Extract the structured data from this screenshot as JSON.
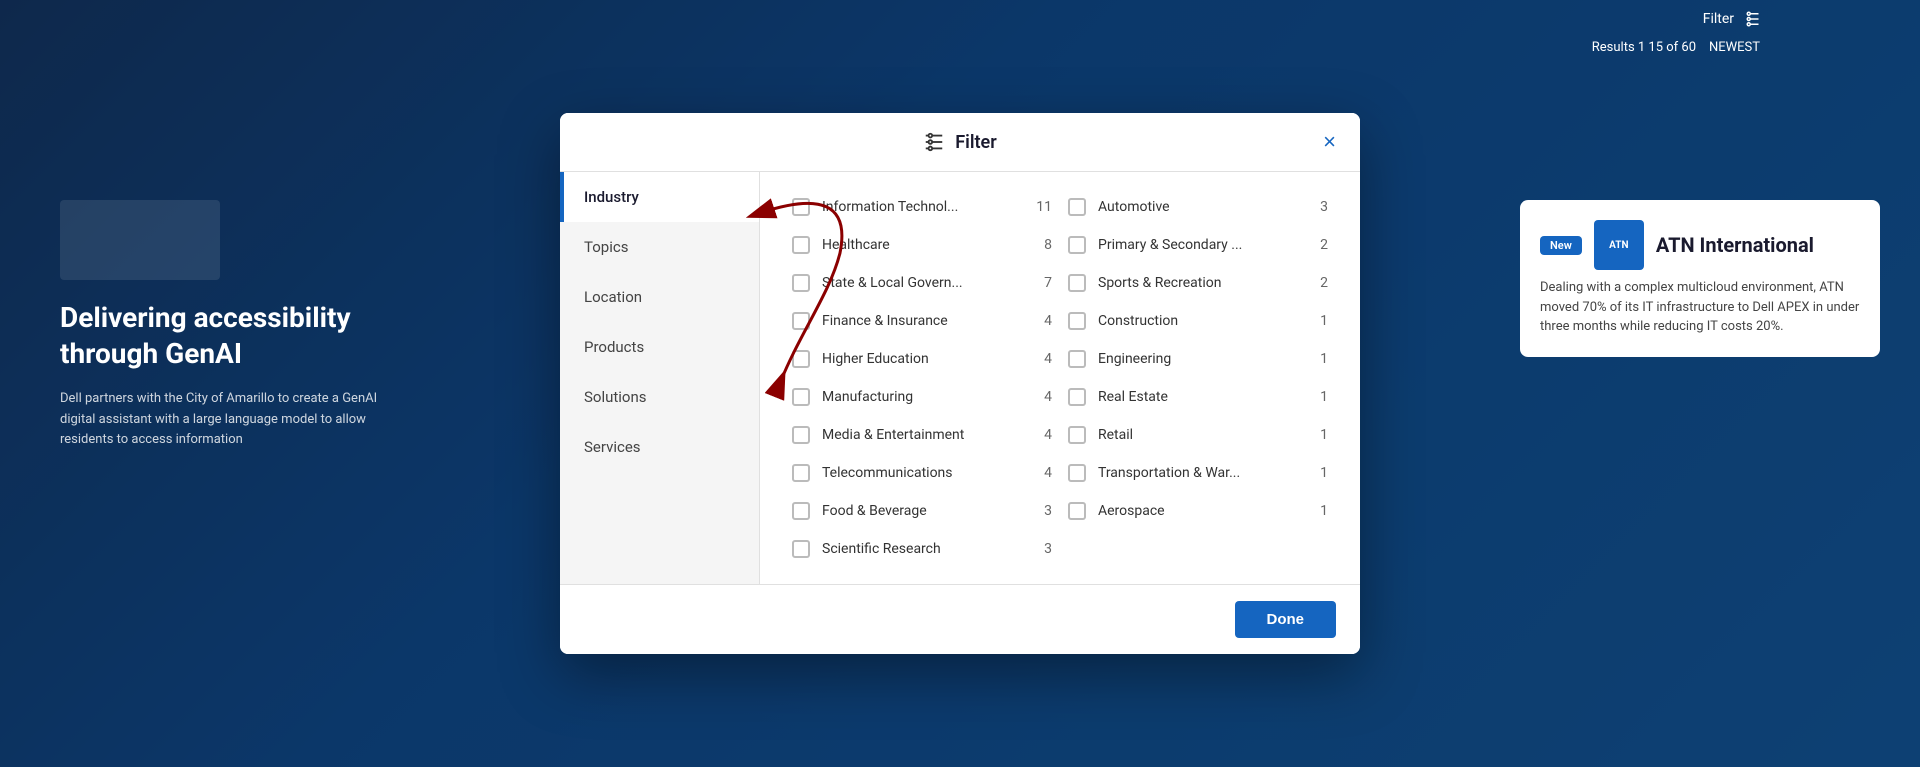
{
  "background": {
    "left_heading": "Delivering accessibility through GenAI",
    "left_body": "Dell partners with the City of Amarillo to create a GenAI digital assistant with a large language model to allow residents to access information",
    "right_company": "ATN International",
    "right_body": "Dealing with a complex multicloud environment, ATN moved 70% of its IT infrastructure to Dell APEX in under three months while reducing IT costs 20%.",
    "new_badge": "New",
    "filter_label": "Filter",
    "results_label": "Results 1 15 of 60",
    "newest_label": "NEWEST"
  },
  "modal": {
    "title": "Filter",
    "close_label": "×",
    "done_label": "Done"
  },
  "sidebar": {
    "items": [
      {
        "id": "industry",
        "label": "Industry",
        "active": true
      },
      {
        "id": "topics",
        "label": "Topics",
        "active": false
      },
      {
        "id": "location",
        "label": "Location",
        "active": false
      },
      {
        "id": "products",
        "label": "Products",
        "active": false
      },
      {
        "id": "solutions",
        "label": "Solutions",
        "active": false
      },
      {
        "id": "services",
        "label": "Services",
        "active": false
      }
    ]
  },
  "filters": {
    "left_column": [
      {
        "id": "info-tech",
        "label": "Information Technol...",
        "count": 11,
        "checked": false
      },
      {
        "id": "healthcare",
        "label": "Healthcare",
        "count": 8,
        "checked": false
      },
      {
        "id": "state-local",
        "label": "State & Local Govern...",
        "count": 7,
        "checked": false
      },
      {
        "id": "finance",
        "label": "Finance & Insurance",
        "count": 4,
        "checked": false
      },
      {
        "id": "higher-ed",
        "label": "Higher Education",
        "count": 4,
        "checked": false
      },
      {
        "id": "manufacturing",
        "label": "Manufacturing",
        "count": 4,
        "checked": false
      },
      {
        "id": "media",
        "label": "Media & Entertainment",
        "count": 4,
        "checked": false
      },
      {
        "id": "telecom",
        "label": "Telecommunications",
        "count": 4,
        "checked": false
      },
      {
        "id": "food-bev",
        "label": "Food & Beverage",
        "count": 3,
        "checked": false
      },
      {
        "id": "sci-research",
        "label": "Scientific Research",
        "count": 3,
        "checked": false
      }
    ],
    "right_column": [
      {
        "id": "automotive",
        "label": "Automotive",
        "count": 3,
        "checked": false
      },
      {
        "id": "primary-secondary",
        "label": "Primary & Secondary ...",
        "count": 2,
        "checked": false
      },
      {
        "id": "sports-rec",
        "label": "Sports & Recreation",
        "count": 2,
        "checked": false
      },
      {
        "id": "construction",
        "label": "Construction",
        "count": 1,
        "checked": false
      },
      {
        "id": "engineering",
        "label": "Engineering",
        "count": 1,
        "checked": false
      },
      {
        "id": "real-estate",
        "label": "Real Estate",
        "count": 1,
        "checked": false
      },
      {
        "id": "retail",
        "label": "Retail",
        "count": 1,
        "checked": false
      },
      {
        "id": "transport",
        "label": "Transportation & War...",
        "count": 1,
        "checked": false
      },
      {
        "id": "aerospace",
        "label": "Aerospace",
        "count": 1,
        "checked": false
      }
    ]
  }
}
